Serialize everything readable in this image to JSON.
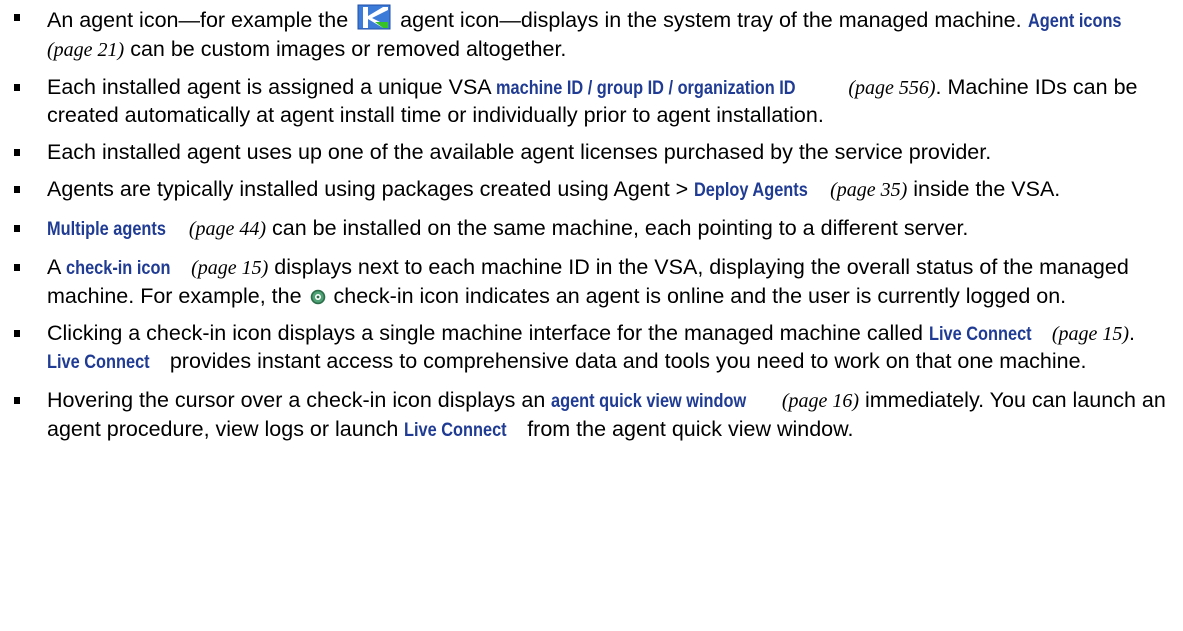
{
  "bullets": [
    {
      "t1": "An agent icon—for example the",
      "t2": "agent icon—displays in the system tray of the managed machine.",
      "link1": "Agent icons",
      "page1": "(page 21)",
      "t3": "can be custom images or removed altogether."
    },
    {
      "t1": "Each installed agent is assigned a unique VSA",
      "link1": "machine ID / group ID / organization ID",
      "page1": "(page 556)",
      "t2": ". Machine IDs can be created automatically at agent install time or individually prior to agent installation."
    },
    {
      "t1": "Each installed agent uses up one of the available agent licenses purchased by the service provider."
    },
    {
      "t1": "Agents are typically installed using packages created using Agent >",
      "link1": "Deploy Agents",
      "page1": "(page 35)",
      "t2": "inside the VSA."
    },
    {
      "link1": "Multiple agents",
      "page1": "(page 44)",
      "t1": "can be installed on the same machine, each pointing to a different server."
    },
    {
      "t1": "A",
      "link1": "check-in icon",
      "page1": "(page 15)",
      "t2": "displays next to each machine ID in the VSA, displaying the overall status of the managed machine. For example, the",
      "t3": "check-in icon indicates an agent is online and the user is currently logged on."
    },
    {
      "t1": "Clicking a check-in icon displays a single machine interface for the managed machine called",
      "link1": "Live Connect",
      "page1": "(page 15)",
      "t2": ".",
      "link2": "Live Connect",
      "t3": "provides instant access to comprehensive data and tools you need to work on that one machine."
    },
    {
      "t1": "Hovering the cursor over a check-in icon displays an",
      "link1": "agent quick view window",
      "page1": "(page 16)",
      "t2": "immediately. You can launch an agent procedure, view logs or launch",
      "link2": "Live Connect",
      "t3": "from the agent quick view window."
    }
  ],
  "icons": {
    "agent_icon": "kaseya-agent-icon",
    "checkin_icon": "checkin-online-icon",
    "link_color": "#1f3b93"
  }
}
